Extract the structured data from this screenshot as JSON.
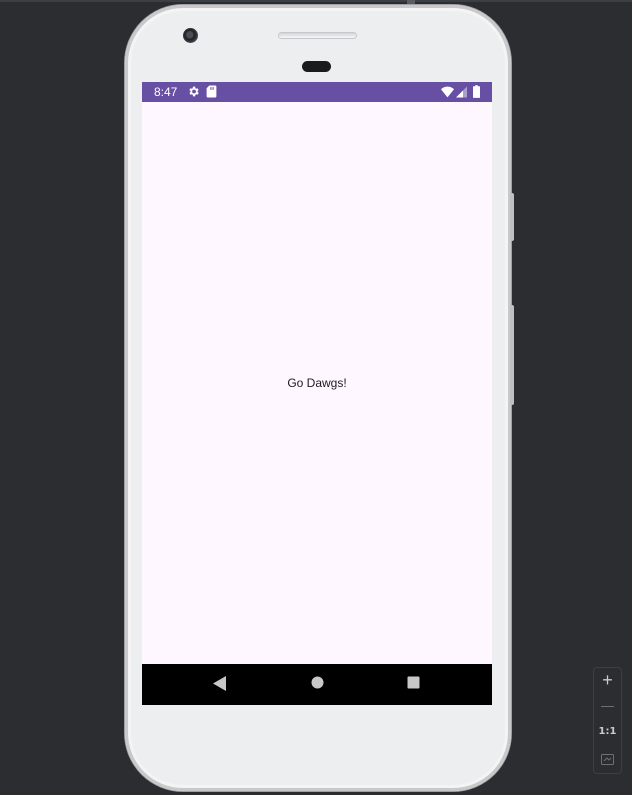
{
  "status_bar": {
    "time": "8:47",
    "background_color": "#6750a4",
    "left_icons": [
      "settings-gear-icon",
      "sd-card-icon"
    ],
    "right_icons": [
      "wifi-icon",
      "cell-signal-icon",
      "battery-icon"
    ]
  },
  "app": {
    "background_color": "#fef7ff",
    "text": "Go Dawgs!"
  },
  "nav_bar": {
    "buttons": [
      "back-icon",
      "home-icon",
      "recents-icon"
    ]
  },
  "zoom_controls": {
    "zoom_in_label": "+",
    "actual_size_label": "1:1",
    "items": [
      "zoom-in-icon",
      "zoom-out-icon",
      "actual-size",
      "fit-screen-icon"
    ]
  }
}
